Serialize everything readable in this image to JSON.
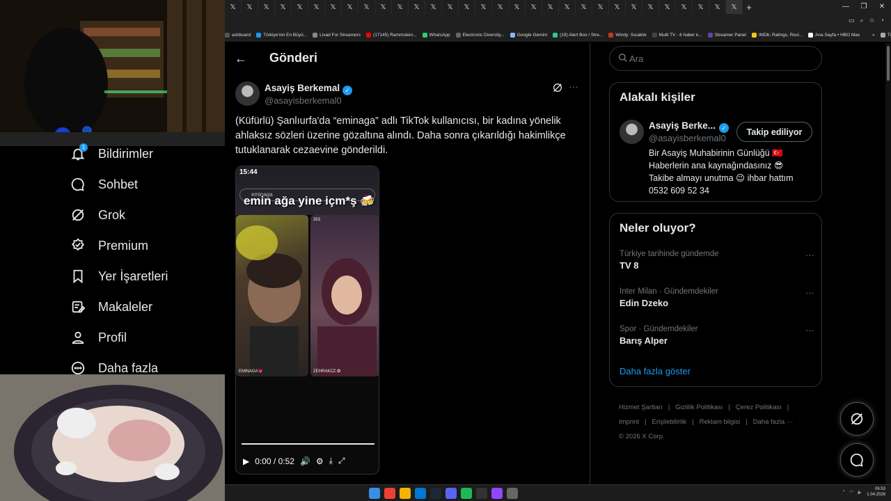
{
  "browser": {
    "tab_glyph": "𝕏",
    "tab_count": 31,
    "new_tab": "+",
    "window_controls": [
      "—",
      "❐",
      "✕"
    ],
    "bookmarks": [
      {
        "label": "ashboard",
        "color": "#555"
      },
      {
        "label": "Türkiye'nin En Büyü...",
        "color": "#1d9bf0"
      },
      {
        "label": "Livad For Streamers",
        "color": "#888"
      },
      {
        "label": "(17145) Rammstein...",
        "color": "#ff0000"
      },
      {
        "label": "WhatsApp",
        "color": "#25d366"
      },
      {
        "label": "Electronic Diversity...",
        "color": "#666"
      },
      {
        "label": "Google Gemini",
        "color": "#8ab4f8"
      },
      {
        "label": "(19) Alert Box / Stre...",
        "color": "#31c3a2"
      },
      {
        "label": "Windy: Sıcaklık",
        "color": "#c0392b"
      },
      {
        "label": "Multi TV - 6 haber k...",
        "color": "#444"
      },
      {
        "label": "Streamer Panel",
        "color": "#6441a5"
      },
      {
        "label": "IMDb: Ratings, Revi...",
        "color": "#f5c518"
      },
      {
        "label": "Ana Sayfa • HBO Max",
        "color": "#fff"
      },
      {
        "label": "»",
        "color": "transparent"
      },
      {
        "label": "Tüm Yer İşaretleri",
        "color": "#aaa"
      }
    ]
  },
  "sidebar": {
    "notification_badge": "1",
    "items": [
      {
        "label": "Bildirimler",
        "icon": "bell-icon"
      },
      {
        "label": "Sohbet",
        "icon": "chat-icon"
      },
      {
        "label": "Grok",
        "icon": "grok-icon"
      },
      {
        "label": "Premium",
        "icon": "premium-badge-icon"
      },
      {
        "label": "Yer İşaretleri",
        "icon": "bookmark-icon"
      },
      {
        "label": "Makaleler",
        "icon": "article-icon"
      },
      {
        "label": "Profil",
        "icon": "person-icon"
      },
      {
        "label": "Daha fazla",
        "icon": "more-circle-icon"
      }
    ]
  },
  "header": {
    "back": "←",
    "title": "Gönderi"
  },
  "post": {
    "author_name": "Asayiş Berkemal",
    "author_handle": "@asayisberkemal0",
    "more": "···",
    "text": "(Küfürlü) Şanlıurfa'da “eminaga” adlı TikTok kullanıcısı, bir kadına yönelik ahlaksız sözleri üzerine gözaltına alındı. Daha sonra çıkarıldığı hakimlikçe tutuklanarak cezaevine gönderildi.",
    "video": {
      "status_time": "15:44",
      "search_text": "eminaga",
      "caption": "emin ağa yine içm*ş 🍻",
      "left_label": "EMINAGA💗",
      "right_label": "ZEHRAKCZ ✪",
      "viewer_count": "353",
      "time": "0:00 / 0:52",
      "progress": 0
    }
  },
  "search": {
    "placeholder": "Ara"
  },
  "related": {
    "title": "Alakalı kişiler",
    "name": "Asayiş Berke...",
    "handle": "@asayisberkemal0",
    "follow_label": "Takip ediliyor",
    "bio_lines": [
      "Bir Asayiş Muhabirinin Günlüğü 🇹🇷",
      "Haberlerin ana kaynağındasınız 😎",
      "Takibe almayı unutma 😉 ihbar hattım",
      "0532 609 52 34"
    ]
  },
  "trends": {
    "title": "Neler oluyor?",
    "items": [
      {
        "context": "Türkiye tarihinde gündemde",
        "name": "TV 8"
      },
      {
        "context": "Inter Milan · Gündemdekiler",
        "name": "Edin Dzeko"
      },
      {
        "context": "Spor · Gündemdekiler",
        "name": "Barış Alper"
      }
    ],
    "more_dots": "···",
    "show_more": "Daha fazla göster"
  },
  "footer": {
    "row1": [
      "Hizmet Şartları",
      "|",
      "Gizlilik Politikası",
      "|",
      "Çerez Politikası",
      "|"
    ],
    "row2": [
      "Imprint",
      "|",
      "Erişilebilirlik",
      "|",
      "Reklam bilgisi",
      "|",
      "Daha fazla ···"
    ],
    "copyright": "© 2026 X Corp."
  },
  "taskbar": {
    "time": "06:53",
    "date": "1.04.2026",
    "app_colors": [
      "#3a8ee6",
      "#e94235",
      "#f5b400",
      "#0078d4",
      "#1b2838",
      "#5865f2",
      "#1db954",
      "#333",
      "#9146ff",
      "#666"
    ]
  },
  "colors": {
    "accent": "#1d9bf0",
    "bg": "#000000",
    "border": "#2f3336",
    "muted": "#71767b"
  }
}
